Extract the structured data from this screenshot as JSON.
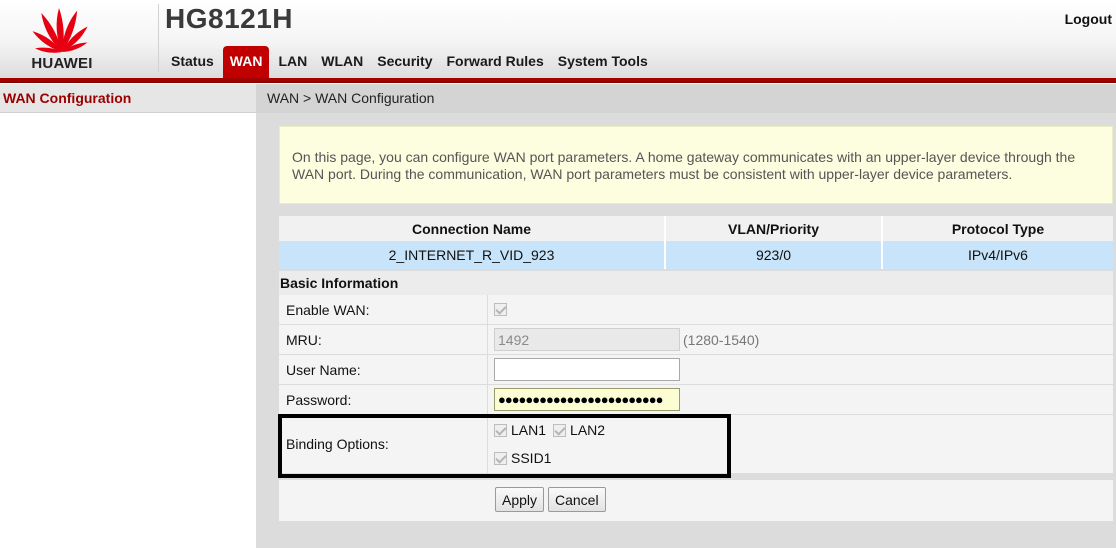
{
  "header": {
    "logo_text": "HUAWEI",
    "model": "HG8121H",
    "logout_label": "Logout"
  },
  "nav": {
    "items": [
      {
        "label": "Status"
      },
      {
        "label": "WAN",
        "active": true
      },
      {
        "label": "LAN"
      },
      {
        "label": "WLAN"
      },
      {
        "label": "Security"
      },
      {
        "label": "Forward Rules"
      },
      {
        "label": "System Tools"
      }
    ]
  },
  "sidebar": {
    "items": [
      {
        "label": "WAN Configuration",
        "active": true
      }
    ]
  },
  "main": {
    "breadcrumb": "WAN > WAN Configuration",
    "notice": "On this page, you can configure WAN port parameters. A home gateway communicates with an upper-layer device through the WAN port. During the communication, WAN port parameters must be consistent with upper-layer device parameters.",
    "table": {
      "headers": [
        "Connection Name",
        "VLAN/Priority",
        "Protocol Type"
      ],
      "rows": [
        [
          "2_INTERNET_R_VID_923",
          "923/0",
          "IPv4/IPv6"
        ]
      ]
    },
    "basic_title": "Basic Information",
    "form": {
      "enable_wan_label": "Enable WAN:",
      "enable_wan_checked": true,
      "mru_label": "MRU:",
      "mru_value": "1492",
      "mru_hint": "(1280-1540)",
      "username_label": "User Name:",
      "username_value": "",
      "password_label": "Password:",
      "password_value": "●●●●●●●●●●●●●●●●●●●●●●●●",
      "binding_label": "Binding Options:",
      "binding_options": [
        "LAN1",
        "LAN2",
        "SSID1"
      ]
    },
    "buttons": {
      "apply_label": "Apply",
      "cancel_label": "Cancel"
    }
  },
  "colors": {
    "brand_red": "#c00000",
    "selected_row": "#c8e4fa",
    "notice_bg": "#fdfde0"
  }
}
